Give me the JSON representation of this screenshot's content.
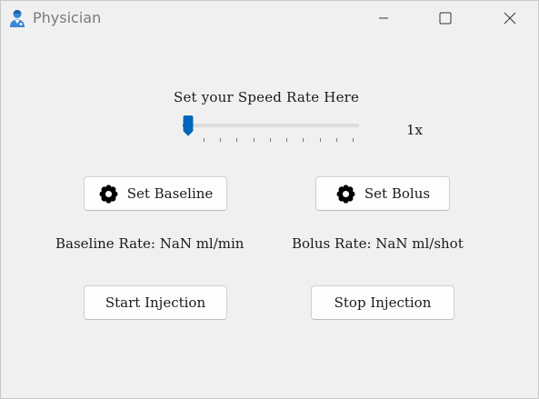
{
  "window": {
    "title": "Physician",
    "app_icon": "doctor-icon",
    "controls": [
      "minimize-icon",
      "maximize-icon",
      "close-icon"
    ]
  },
  "speed": {
    "label": "Set your Speed Rate Here",
    "value_text": "1x",
    "slider_level": 0,
    "tick_count": 10,
    "accent_color": "#0067c0"
  },
  "buttons": {
    "set_baseline": "Set Baseline",
    "set_bolus": "Set Bolus",
    "start_injection": "Start Injection",
    "stop_injection": "Stop Injection"
  },
  "rates": {
    "baseline": "Baseline Rate: NaN ml/min",
    "bolus": "Bolus Rate: NaN ml/shot"
  }
}
